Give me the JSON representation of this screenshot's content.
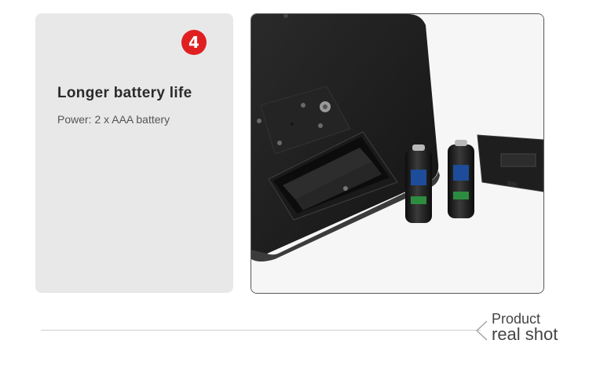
{
  "feature": {
    "number": "4",
    "title": "Longer battery life",
    "subtitle": "Power: 2 x AAA battery"
  },
  "caption": {
    "line1": "Product",
    "line2": "real shot"
  },
  "colors": {
    "badge": "#e02020",
    "card_bg": "#e8e8e8",
    "device": "#1c1c1c"
  },
  "icons": {
    "caption_chevron": "chevron-left-icon"
  }
}
